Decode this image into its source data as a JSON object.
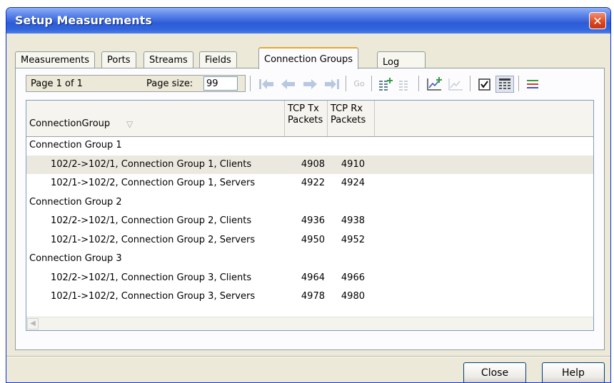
{
  "window": {
    "title": "Setup Measurements",
    "close_glyph": "✕"
  },
  "tabs": [
    {
      "label": "Measurements",
      "active": false
    },
    {
      "label": "Ports",
      "active": false
    },
    {
      "label": "Streams",
      "active": false
    },
    {
      "label": "Fields",
      "active": false
    },
    {
      "label": "Connection Groups",
      "active": true
    },
    {
      "label": "Log",
      "active": false
    }
  ],
  "toolbar": {
    "page_info": "Page 1 of 1",
    "page_size_label": "Page size:",
    "page_size_value": "99",
    "go_label": "Go",
    "icons": [
      "first-page-icon",
      "previous-page-icon",
      "next-page-icon",
      "last-page-icon",
      "add-columns-icon",
      "remove-columns-icon",
      "add-chart-icon",
      "remove-chart-icon",
      "checkbox-icon",
      "grid-view-icon",
      "list-view-icon"
    ]
  },
  "grid": {
    "columns": [
      {
        "label": "ConnectionGroup"
      },
      {
        "label_line1": "TCP Tx",
        "label_line2": "Packets"
      },
      {
        "label_line1": "TCP Rx",
        "label_line2": "Packets"
      }
    ],
    "sort_indicator": "▽",
    "rows": [
      {
        "group": true,
        "name": "Connection Group 1",
        "tx": "",
        "rx": ""
      },
      {
        "group": false,
        "name": "102/2->102/1, Connection Group 1, Clients",
        "tx": "4908",
        "rx": "4910",
        "selected": true
      },
      {
        "group": false,
        "name": "102/1->102/2, Connection Group 1, Servers",
        "tx": "4922",
        "rx": "4924"
      },
      {
        "group": true,
        "name": "Connection Group 2",
        "tx": "",
        "rx": ""
      },
      {
        "group": false,
        "name": "102/2->102/1, Connection Group 2, Clients",
        "tx": "4936",
        "rx": "4938"
      },
      {
        "group": false,
        "name": "102/1->102/2, Connection Group 2, Servers",
        "tx": "4950",
        "rx": "4952"
      },
      {
        "group": true,
        "name": "Connection Group 3",
        "tx": "",
        "rx": ""
      },
      {
        "group": false,
        "name": "102/2->102/1, Connection Group 3, Clients",
        "tx": "4964",
        "rx": "4966"
      },
      {
        "group": false,
        "name": "102/1->102/2, Connection Group 3, Servers",
        "tx": "4978",
        "rx": "4980"
      }
    ]
  },
  "buttons": {
    "close": "Close",
    "help": "Help"
  },
  "colors": {
    "titlebar": "#2d5bd6",
    "window_bg": "#ece9d8",
    "active_tab_accent": "#e7a631",
    "close_button": "#d9481d"
  }
}
